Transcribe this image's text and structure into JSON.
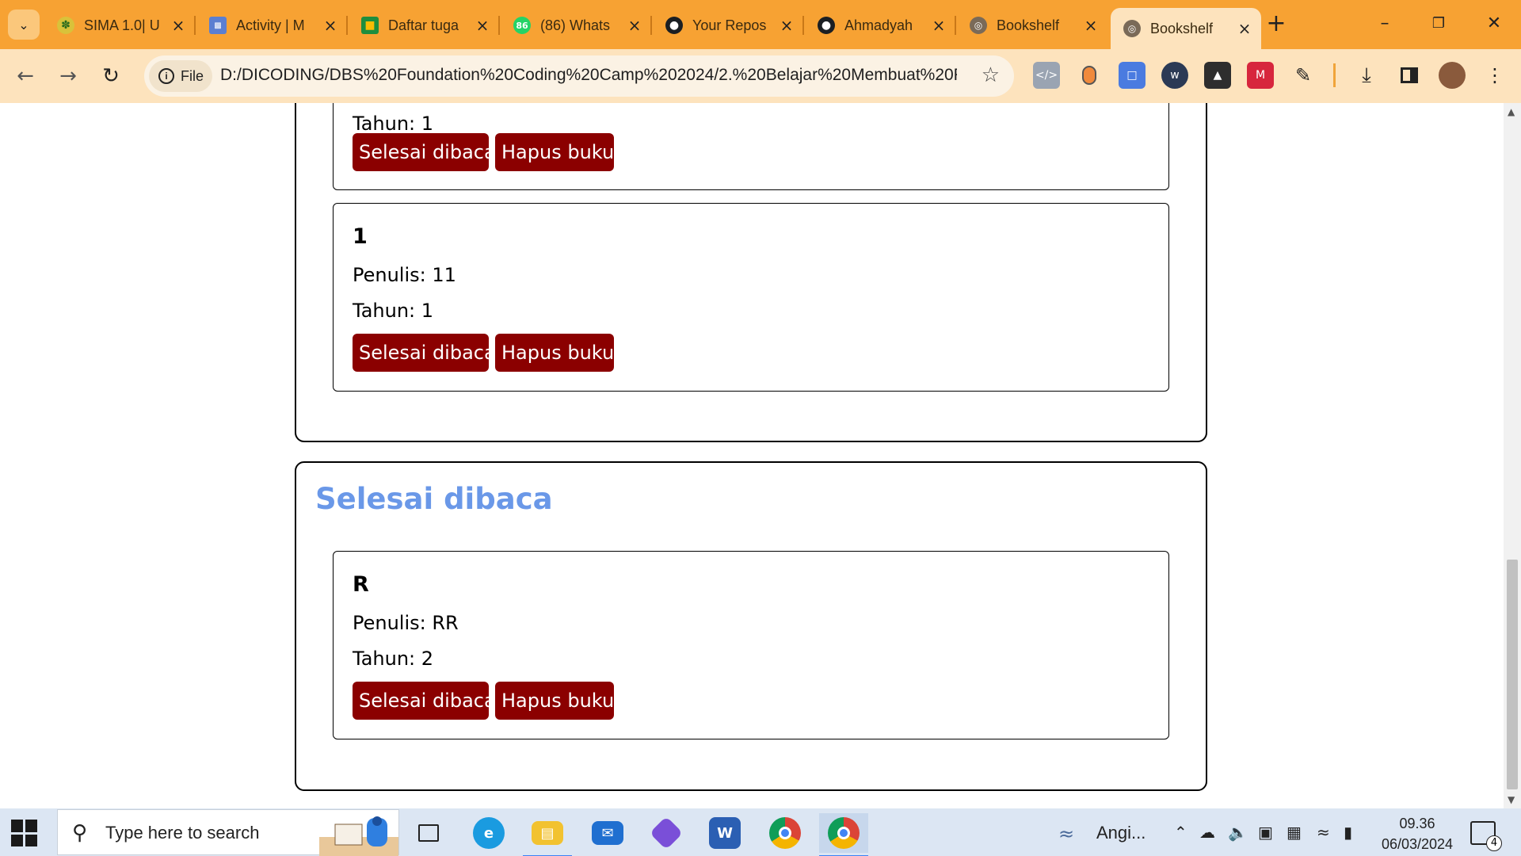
{
  "browser": {
    "tabs": [
      {
        "title": "SIMA 1.0| U",
        "icon": "sima-favicon"
      },
      {
        "title": "Activity | M",
        "icon": "activity-favicon"
      },
      {
        "title": "Daftar tuga",
        "icon": "classroom-favicon"
      },
      {
        "title": "(86) Whats",
        "icon": "whatsapp-favicon",
        "badge": "86"
      },
      {
        "title": "Your Repos",
        "icon": "github-favicon"
      },
      {
        "title": "Ahmadyah",
        "icon": "github-favicon"
      },
      {
        "title": "Bookshelf",
        "icon": "globe-favicon"
      },
      {
        "title": "Bookshelf",
        "icon": "globe-favicon",
        "active": true
      }
    ],
    "address": {
      "chip_label": "File",
      "url": "D:/DICODING/DBS%20Foundation%20Coding%20Camp%202024/2.%20Belajar%20Membuat%20Fro..."
    },
    "accent": "#f7a233"
  },
  "page": {
    "top_book": {
      "year": "Tahun: 1",
      "done_label": "Selesai dibaca",
      "delete_label": "Hapus buku"
    },
    "unread_books": [
      {
        "title": "1",
        "author": "Penulis: 11",
        "year": "Tahun: 1",
        "done_label": "Selesai dibaca",
        "delete_label": "Hapus buku"
      }
    ],
    "finished_section": {
      "heading": "Selesai dibaca",
      "books": [
        {
          "title": "R",
          "author": "Penulis: RR",
          "year": "Tahun: 2",
          "done_label": "Selesai dibaca",
          "delete_label": "Hapus buku"
        }
      ]
    },
    "heading_color": "#6a98e8",
    "button_color": "#8b0000"
  },
  "taskbar": {
    "search_placeholder": "Type here to search",
    "weather": "Angi...",
    "time": "09.36",
    "date": "06/03/2024",
    "notification_count": "4"
  }
}
